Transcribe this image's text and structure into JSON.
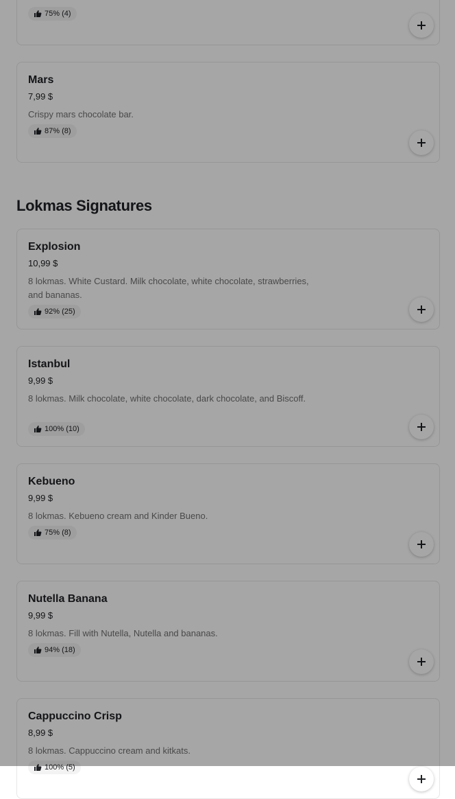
{
  "cards_top": [
    {
      "name": "",
      "price": "",
      "description": "",
      "rating": "75% (4)"
    },
    {
      "name": "Mars",
      "price": "7,99 $",
      "description": "Crispy mars chocolate bar.",
      "rating": "87% (8)"
    }
  ],
  "section": {
    "title": "Lokmas Signatures",
    "items": [
      {
        "name": "Explosion",
        "price": "10,99 $",
        "description": "8 lokmas. White Custard. Milk chocolate, white chocolate, strawberries, and bananas.",
        "rating": "92% (25)"
      },
      {
        "name": "Istanbul",
        "price": "9,99 $",
        "description": "8 lokmas. Milk chocolate, white chocolate, dark chocolate, and Biscoff.",
        "rating": "100% (10)"
      },
      {
        "name": "Kebueno",
        "price": "9,99 $",
        "description": "8 lokmas. Kebueno cream and Kinder Bueno.",
        "rating": "75% (8)"
      },
      {
        "name": "Nutella Banana",
        "price": "9,99 $",
        "description": "8 lokmas. Fill with Nutella, Nutella and bananas.",
        "rating": "94% (18)"
      },
      {
        "name": "Cappuccino Crisp",
        "price": "8,99 $",
        "description": "8 lokmas. Cappuccino cream and kitkats.",
        "rating": "100% (5)"
      }
    ]
  },
  "icons": {
    "rating": "thumbs-up-icon",
    "add": "plus-icon"
  },
  "colors": {
    "overlay": "#000000",
    "text": "#202125",
    "muted": "#707070"
  }
}
